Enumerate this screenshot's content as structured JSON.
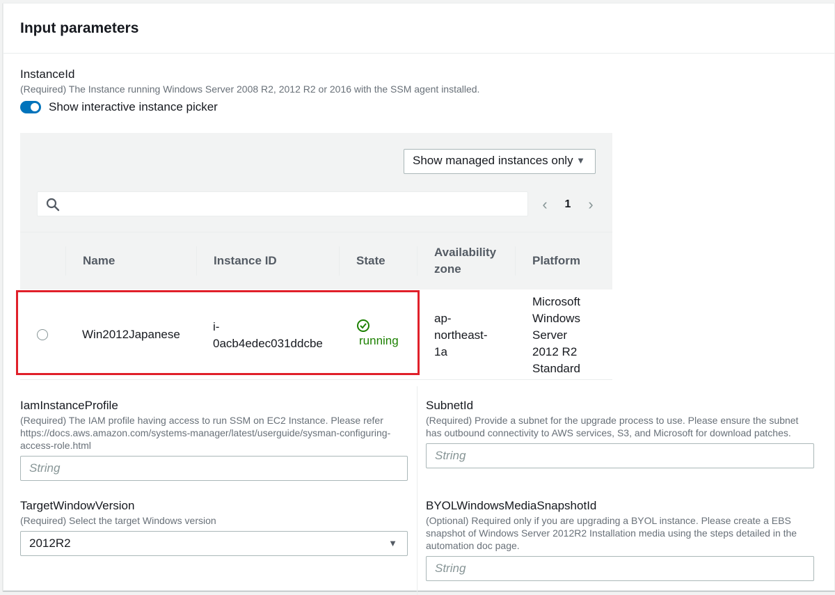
{
  "panel": {
    "title": "Input parameters"
  },
  "instance_id": {
    "label": "InstanceId",
    "description": "(Required) The Instance running Windows Server 2008 R2, 2012 R2 or 2016 with the SSM agent installed.",
    "toggle_label": "Show interactive instance picker",
    "toggle_on": true
  },
  "picker": {
    "filter_dropdown": "Show managed instances only",
    "search_placeholder": "",
    "page": "1",
    "columns": [
      "Name",
      "Instance ID",
      "State",
      "Availability zone",
      "Platform"
    ],
    "rows": [
      {
        "name": "Win2012Japanese",
        "instance_id": "i-0acb4edec031ddcbe",
        "instance_id_lines": [
          "i-",
          "0acb4edec031ddcbe"
        ],
        "state": "running",
        "az_lines": [
          "ap-",
          "northeast-",
          "1a"
        ],
        "platform_lines": [
          "Microsoft",
          "Windows",
          "Server",
          "2012 R2",
          "Standard"
        ]
      }
    ]
  },
  "iam_profile": {
    "label": "IamInstanceProfile",
    "description": "(Required) The IAM profile having access to run SSM on EC2 Instance. Please refer https://docs.aws.amazon.com/systems-manager/latest/userguide/sysman-configuring-access-role.html",
    "placeholder": "String"
  },
  "subnet": {
    "label": "SubnetId",
    "description": "(Required) Provide a subnet for the upgrade process to use. Please ensure the subnet has outbound connectivity to AWS services, S3, and Microsoft for download patches.",
    "placeholder": "String"
  },
  "target_version": {
    "label": "TargetWindowVersion",
    "description": "(Required) Select the target Windows version",
    "value": "2012R2"
  },
  "byol": {
    "label": "BYOLWindowsMediaSnapshotId",
    "description": "(Optional) Required only if you are upgrading a BYOL instance. Please create a EBS snapshot of Windows Server 2012R2 Installation media using the steps detailed in the automation doc page.",
    "placeholder": "String"
  },
  "colors": {
    "toggle_on": "#0073bb",
    "running": "#1d8102",
    "highlight": "#e0202a"
  }
}
